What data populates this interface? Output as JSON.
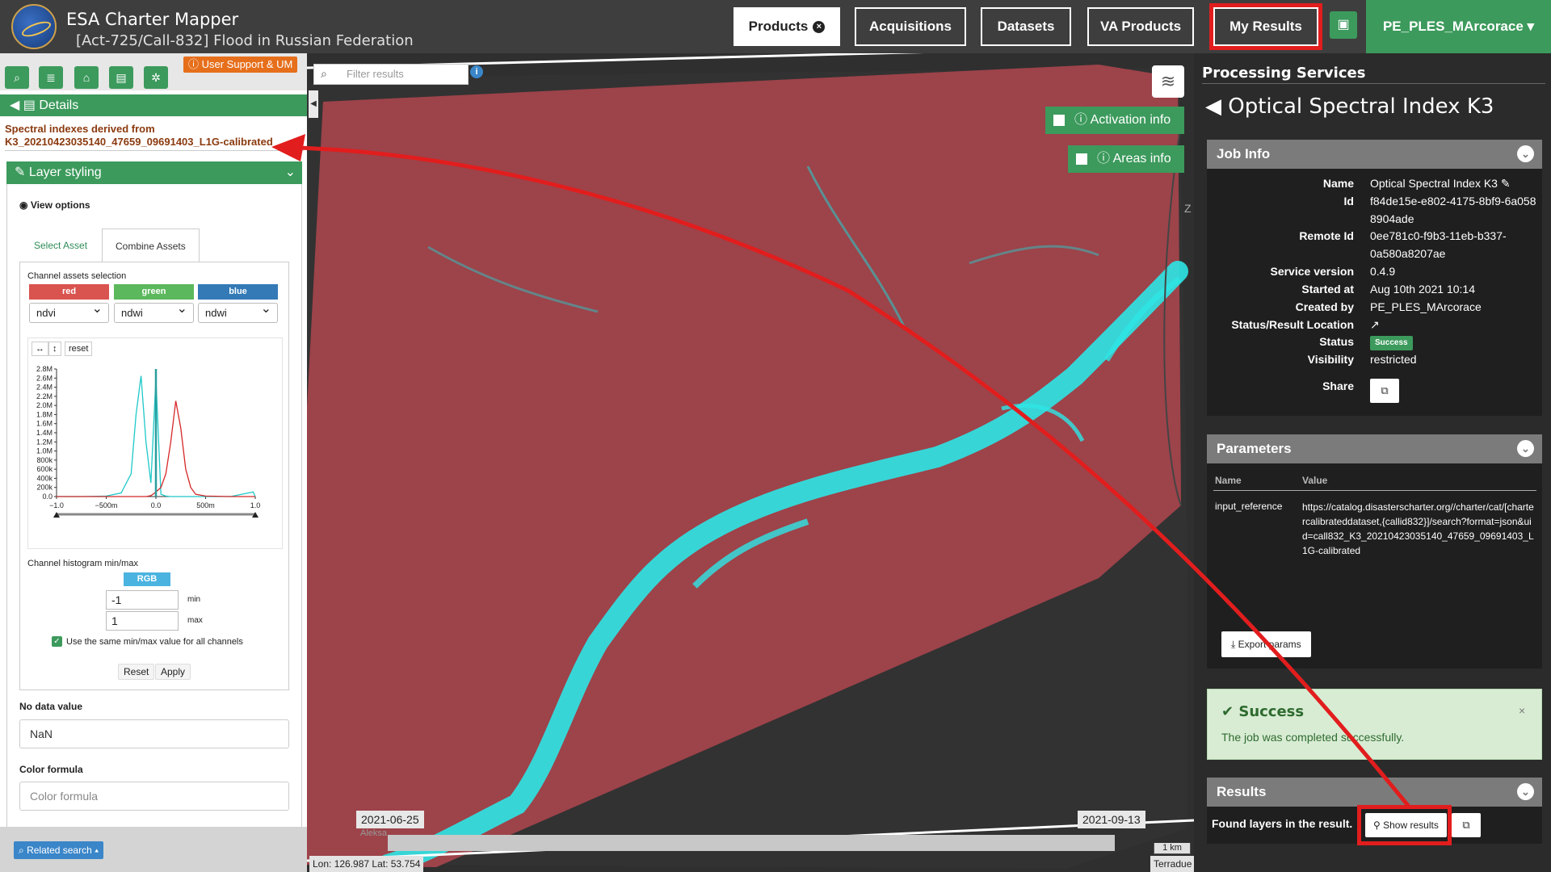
{
  "header": {
    "app_title": "ESA Charter Mapper",
    "activation": "[Act-725/Call-832] Flood in Russian Federation",
    "nav": [
      {
        "label": "Products",
        "active": true
      },
      {
        "label": "Acquisitions"
      },
      {
        "label": "Datasets"
      },
      {
        "label": "VA Products"
      },
      {
        "label": "My Results",
        "highlighted": true
      }
    ],
    "user": "PE_PLES_MArcorace ▾",
    "close_glyph": "×"
  },
  "left": {
    "support": "ⓘ User Support & UM",
    "details": "Details",
    "layer_title": "Spectral indexes derived from K3_20210423035140_47659_09691403_L1G-calibrated",
    "styling_title": "Layer styling",
    "view_options": "View options",
    "tabs": [
      "Select Asset",
      "Combine Assets"
    ],
    "channel_selection_label": "Channel assets selection",
    "channels": [
      {
        "name": "red",
        "color": "#d9534f",
        "value": "ndvi"
      },
      {
        "name": "green",
        "color": "#5cb85c",
        "value": "ndwi"
      },
      {
        "name": "blue",
        "color": "#337ab7",
        "value": "ndwi"
      }
    ],
    "histo_reset": "reset",
    "histogram_label": "Channel histogram min/max",
    "rgb_label": "RGB",
    "min_value": "-1",
    "max_value": "1",
    "min_label": "min",
    "max_label": "max",
    "same_minmax_label": "Use the same min/max value for all channels",
    "reset_btn": "Reset",
    "apply_btn": "Apply",
    "nodata_label": "No data value",
    "nodata_value": "NaN",
    "formula_label": "Color formula",
    "formula_placeholder": "Color formula",
    "related_search": "Related search ▴"
  },
  "chart_data": {
    "type": "line",
    "x": [
      -1.0,
      -0.75,
      -0.5,
      -0.35,
      -0.25,
      -0.2,
      -0.15,
      -0.1,
      -0.05,
      0.0,
      0.05,
      0.1,
      0.15,
      0.2,
      0.25,
      0.3,
      0.35,
      0.4,
      0.5,
      0.75,
      0.98,
      1.0
    ],
    "series": [
      {
        "color": "#1ec8c8",
        "values": [
          0,
          0,
          0.01,
          0.08,
          0.5,
          1.8,
          2.65,
          1.2,
          0.3,
          2.6,
          0.05,
          0.01,
          0,
          0,
          0,
          0,
          0,
          0,
          0,
          0,
          0.1,
          0
        ]
      },
      {
        "color": "#d62728",
        "values": [
          0,
          0,
          0,
          0,
          0,
          0,
          0,
          0,
          0.02,
          0.1,
          0.2,
          0.5,
          1.2,
          2.1,
          1.5,
          0.6,
          0.2,
          0.05,
          0.01,
          0,
          0,
          0
        ]
      }
    ],
    "xticks": [
      "−1.0",
      "−500m",
      "0.0",
      "500m",
      "1.0"
    ],
    "xtick_values": [
      -1.0,
      -0.5,
      0.0,
      0.5,
      1.0
    ],
    "yticks": [
      "0.0",
      "200k",
      "400k",
      "600k",
      "800k",
      "1.0M",
      "1.2M",
      "1.4M",
      "1.6M",
      "1.8M",
      "2.0M",
      "2.2M",
      "2.4M",
      "2.6M",
      "2.8M"
    ],
    "ytick_values": [
      0,
      0.2,
      0.4,
      0.6,
      0.8,
      1.0,
      1.2,
      1.4,
      1.6,
      1.8,
      2.0,
      2.2,
      2.4,
      2.6,
      2.8
    ],
    "xlim": [
      -1.0,
      1.0
    ],
    "ylim": [
      0,
      2.8
    ]
  },
  "map": {
    "filter_placeholder": "Filter results",
    "activation_info": "ⓘ Activation info",
    "areas_info": "ⓘ Areas info",
    "date_start": "2021-06-25",
    "date_end": "2021-09-13",
    "scale": "1 km",
    "coords": "Lon: 126.987 Lat: 53.754",
    "attribution": "Terradue",
    "z_label": "Z",
    "place_label": "Aleksa"
  },
  "right": {
    "section_title": "Processing Services",
    "service_title": "Optical Spectral Index K3",
    "job_info_title": "Job Info",
    "job": [
      {
        "key": "Name",
        "value": "Optical Spectral Index K3 ✎"
      },
      {
        "key": "Id",
        "value": "f84de15e-e802-4175-8bf9-6a0588904ade"
      },
      {
        "key": "Remote Id",
        "value": "0ee781c0-f9b3-11eb-b337-0a580a8207ae"
      },
      {
        "key": "Service version",
        "value": "0.4.9"
      },
      {
        "key": "Started at",
        "value": "Aug 10th 2021 10:14"
      },
      {
        "key": "Created by",
        "value": "PE_PLES_MArcorace"
      },
      {
        "key": "Status/Result Location",
        "value": "↗"
      },
      {
        "key": "Status",
        "value": "Success"
      },
      {
        "key": "Visibility",
        "value": "restricted"
      },
      {
        "key": "Share",
        "value": ""
      }
    ],
    "params_title": "Parameters",
    "param_headers": [
      "Name",
      "Value"
    ],
    "param_name": "input_reference",
    "param_value": "https://catalog.disasterscharter.org//charter/cat/[chartercalibrateddataset,{callid832}]/search?format=json&uid=call832_K3_20210423035140_47659_09691403_L1G-calibrated",
    "export_btn": "⤓ Export params",
    "success_title": "Success",
    "success_msg": "The job was completed successfully.",
    "results_title": "Results",
    "results_text": "Found layers in the result.",
    "show_results": "Show results"
  }
}
